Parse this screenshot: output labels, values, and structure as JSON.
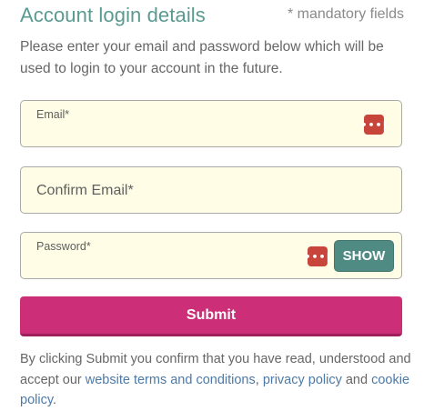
{
  "header": {
    "title": "Account login details",
    "mandatory_note": "* mandatory fields"
  },
  "intro_text": "Please enter your email and password below which will be used to login to your account in the future.",
  "fields": {
    "email": {
      "label": "Email*",
      "value": "",
      "icon": "password-manager-icon"
    },
    "confirm_email": {
      "placeholder": "Confirm Email*",
      "value": ""
    },
    "password": {
      "label": "Password*",
      "value": "",
      "icon": "password-manager-icon",
      "show_label": "SHOW"
    }
  },
  "submit_label": "Submit",
  "legal": {
    "prefix": "By clicking Submit you confirm that you have read, understood and accept our ",
    "terms_link": "website terms and conditions",
    "separator": ", ",
    "privacy_link": "privacy policy",
    "and_text": " and ",
    "cookie_link": "cookie policy",
    "suffix": "."
  },
  "colors": {
    "title": "#5a9a91",
    "field_bg": "#fffde6",
    "icon_red": "#c8453c",
    "show_button": "#4f8b83",
    "submit": "#cc2f78",
    "link": "#4c7aa8"
  }
}
